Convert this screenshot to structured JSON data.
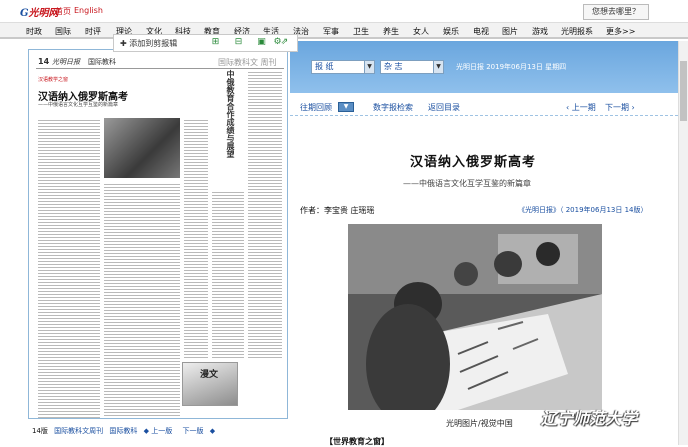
{
  "topbar": {
    "logo_g": "G",
    "logo_text": "光明网",
    "home": "首页",
    "english": "English",
    "where_button": "您想去哪里？"
  },
  "nav": [
    "时政",
    "国际",
    "时评",
    "理论",
    "文化",
    "科技",
    "教育",
    "经济",
    "生活",
    "法治",
    "军事",
    "卫生",
    "养生",
    "女人",
    "娱乐",
    "电视",
    "图片",
    "游戏",
    "光明报系",
    "更多>>"
  ],
  "clip_toolbar": {
    "add_label": "添加到剪报辑",
    "icons": [
      "plus-icon",
      "zoom-in-icon",
      "zoom-out-icon",
      "save-icon",
      "share-icon",
      "settings-icon"
    ]
  },
  "paper": {
    "page_label": "14",
    "masthead": "光明日报",
    "section": "国际教科",
    "section_right": "国际教科文 周刊",
    "column_tag": "汉语教学之窗",
    "title": "汉语纳入俄罗斯高考",
    "subtitle": "——中俄语言文化互学互鉴的新篇章",
    "side_title": "中俄教育合作成绩与展望",
    "cartoon_label": "漫文",
    "page_nav": {
      "page": "14版",
      "weekly": "国际教科文周刊",
      "section": "国际教科",
      "prev": "上一版",
      "next": "下一版"
    }
  },
  "right": {
    "select_paper": "报 纸",
    "select_mag": "杂 志",
    "date_line": "光明日报  2019年06月13日  星期四",
    "past_review": "往期回顾",
    "digital_search": "数字报检索",
    "back_toc": "返回目录",
    "prev_issue": "上一期",
    "next_issue": "下一期"
  },
  "article": {
    "title": "汉语纳入俄罗斯高考",
    "subtitle": "——中俄语言文化互学互鉴的新篇章",
    "author": "作者：李宝贵  庄瑶瑶",
    "source_link": "《光明日报》",
    "source_date": "（ 2019年06月13日  14版）",
    "caption": "光明图片/视觉中国",
    "related": "【世界教育之窗】"
  },
  "watermark": "辽宁师范大学",
  "colors": {
    "accent_blue": "#1a4fa0",
    "brand_red": "#c8161d",
    "band_blue": "#7fb3e6"
  }
}
